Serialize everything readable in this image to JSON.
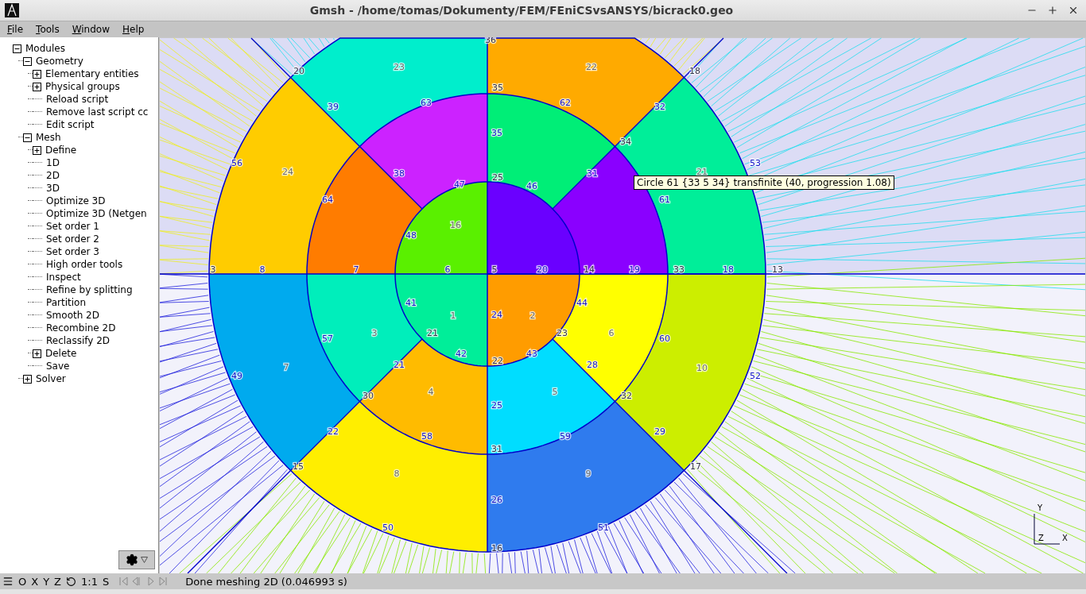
{
  "window": {
    "title": "Gmsh - /home/tomas/Dokumenty/FEM/FEniCSvsANSYS/bicrack0.geo"
  },
  "menu": [
    "File",
    "Tools",
    "Window",
    "Help"
  ],
  "tree": [
    {
      "label": "Modules",
      "expanded": true,
      "children": [
        {
          "label": "Geometry",
          "expanded": true,
          "children": [
            {
              "label": "Elementary entities",
              "expanded": false
            },
            {
              "label": "Physical groups",
              "expanded": false
            },
            {
              "label": "Reload script"
            },
            {
              "label": "Remove last script cc"
            },
            {
              "label": "Edit script"
            }
          ]
        },
        {
          "label": "Mesh",
          "expanded": true,
          "children": [
            {
              "label": "Define",
              "expanded": false
            },
            {
              "label": "1D"
            },
            {
              "label": "2D"
            },
            {
              "label": "3D"
            },
            {
              "label": "Optimize 3D"
            },
            {
              "label": "Optimize 3D (Netgen"
            },
            {
              "label": "Set order 1"
            },
            {
              "label": "Set order 2"
            },
            {
              "label": "Set order 3"
            },
            {
              "label": "High order tools"
            },
            {
              "label": "Inspect"
            },
            {
              "label": "Refine by splitting"
            },
            {
              "label": "Partition"
            },
            {
              "label": "Smooth 2D"
            },
            {
              "label": "Recombine 2D"
            },
            {
              "label": "Reclassify 2D"
            },
            {
              "label": "Delete",
              "expanded": false
            },
            {
              "label": "Save"
            }
          ]
        },
        {
          "label": "Solver",
          "expanded": false
        }
      ]
    }
  ],
  "labels": [
    {
      "text": "36",
      "kind": "point"
    },
    {
      "text": "20",
      "kind": "point"
    },
    {
      "text": "23",
      "kind": "surface"
    },
    {
      "text": "22",
      "kind": "surface"
    },
    {
      "text": "18",
      "kind": "point"
    },
    {
      "text": "35",
      "kind": "point"
    },
    {
      "text": "39",
      "kind": "line"
    },
    {
      "text": "63",
      "kind": "line"
    },
    {
      "text": "62",
      "kind": "line"
    },
    {
      "text": "32",
      "kind": "line"
    },
    {
      "text": "56",
      "kind": "line"
    },
    {
      "text": "24",
      "kind": "surface"
    },
    {
      "text": "35",
      "kind": "line"
    },
    {
      "text": "34",
      "kind": "point"
    },
    {
      "text": "21",
      "kind": "surface"
    },
    {
      "text": "53",
      "kind": "line"
    },
    {
      "text": "64",
      "kind": "line"
    },
    {
      "text": "38",
      "kind": "line"
    },
    {
      "text": "31",
      "kind": "line"
    },
    {
      "text": "25",
      "kind": "point"
    },
    {
      "text": "47",
      "kind": "line"
    },
    {
      "text": "46",
      "kind": "line"
    },
    {
      "text": "61",
      "kind": "line"
    },
    {
      "text": "48",
      "kind": "line"
    },
    {
      "text": "16",
      "kind": "surface"
    },
    {
      "text": "3",
      "kind": "point"
    },
    {
      "text": "8",
      "kind": "line"
    },
    {
      "text": "7",
      "kind": "line"
    },
    {
      "text": "6",
      "kind": "line"
    },
    {
      "text": "5",
      "kind": "point"
    },
    {
      "text": "20",
      "kind": "line"
    },
    {
      "text": "14",
      "kind": "point"
    },
    {
      "text": "19",
      "kind": "line"
    },
    {
      "text": "33",
      "kind": "point"
    },
    {
      "text": "18",
      "kind": "line"
    },
    {
      "text": "13",
      "kind": "point"
    },
    {
      "text": "41",
      "kind": "line"
    },
    {
      "text": "1",
      "kind": "surface"
    },
    {
      "text": "24",
      "kind": "line"
    },
    {
      "text": "2",
      "kind": "surface"
    },
    {
      "text": "44",
      "kind": "line"
    },
    {
      "text": "57",
      "kind": "line"
    },
    {
      "text": "3",
      "kind": "surface"
    },
    {
      "text": "21",
      "kind": "point"
    },
    {
      "text": "23",
      "kind": "point"
    },
    {
      "text": "6",
      "kind": "surface"
    },
    {
      "text": "60",
      "kind": "line"
    },
    {
      "text": "42",
      "kind": "line"
    },
    {
      "text": "43",
      "kind": "line"
    },
    {
      "text": "22",
      "kind": "point"
    },
    {
      "text": "7",
      "kind": "surface"
    },
    {
      "text": "49",
      "kind": "line"
    },
    {
      "text": "21",
      "kind": "line"
    },
    {
      "text": "28",
      "kind": "line"
    },
    {
      "text": "10",
      "kind": "surface"
    },
    {
      "text": "52",
      "kind": "line"
    },
    {
      "text": "30",
      "kind": "point"
    },
    {
      "text": "4",
      "kind": "surface"
    },
    {
      "text": "25",
      "kind": "line"
    },
    {
      "text": "5",
      "kind": "surface"
    },
    {
      "text": "32",
      "kind": "point"
    },
    {
      "text": "22",
      "kind": "line"
    },
    {
      "text": "58",
      "kind": "line"
    },
    {
      "text": "59",
      "kind": "line"
    },
    {
      "text": "29",
      "kind": "line"
    },
    {
      "text": "31",
      "kind": "point"
    },
    {
      "text": "15",
      "kind": "point"
    },
    {
      "text": "8",
      "kind": "surface"
    },
    {
      "text": "9",
      "kind": "surface"
    },
    {
      "text": "17",
      "kind": "point"
    },
    {
      "text": "26",
      "kind": "line"
    },
    {
      "text": "50",
      "kind": "line"
    },
    {
      "text": "51",
      "kind": "line"
    },
    {
      "text": "16",
      "kind": "point"
    }
  ],
  "tooltip": "Circle 61 {33 5 34} transfinite (40, progression 1.08)",
  "axes": [
    "Y",
    "Z",
    "X"
  ],
  "status_bar": {
    "buttons": [
      "O",
      "X",
      "Y",
      "Z"
    ],
    "scale": "1:1",
    "s": "S",
    "playback": {
      "disabled": true
    },
    "message": "Done meshing 2D (0.046993 s)"
  }
}
